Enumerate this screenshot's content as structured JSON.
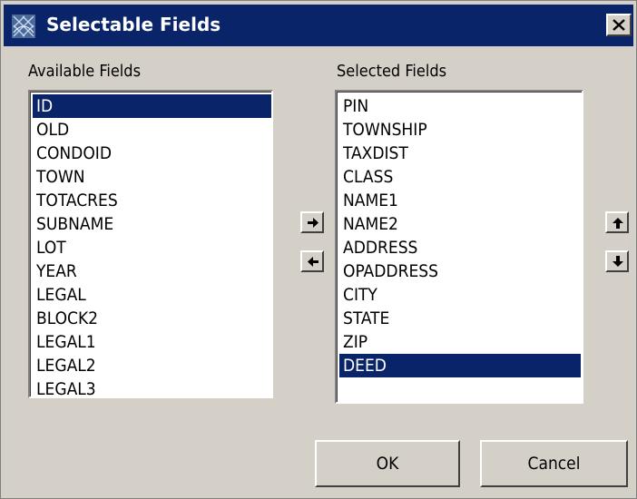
{
  "window": {
    "title": "Selectable Fields"
  },
  "available": {
    "label": "Available Fields",
    "items": [
      "ID",
      "OLD",
      "CONDOID",
      "TOWN",
      "TOTACRES",
      "SUBNAME",
      "LOT",
      "YEAR",
      "LEGAL",
      "BLOCK2",
      "LEGAL1",
      "LEGAL2",
      "LEGAL3"
    ],
    "selected_index": 0
  },
  "selected": {
    "label": "Selected Fields",
    "items": [
      "PIN",
      "TOWNSHIP",
      "TAXDIST",
      "CLASS",
      "NAME1",
      "NAME2",
      "ADDRESS",
      "OPADDRESS",
      "CITY",
      "STATE",
      "ZIP",
      "DEED"
    ],
    "selected_index": 11
  },
  "buttons": {
    "ok": "OK",
    "cancel": "Cancel"
  },
  "colors": {
    "titlebar": "#0a246a",
    "selection": "#0a246a",
    "face": "#d4d0c8"
  }
}
